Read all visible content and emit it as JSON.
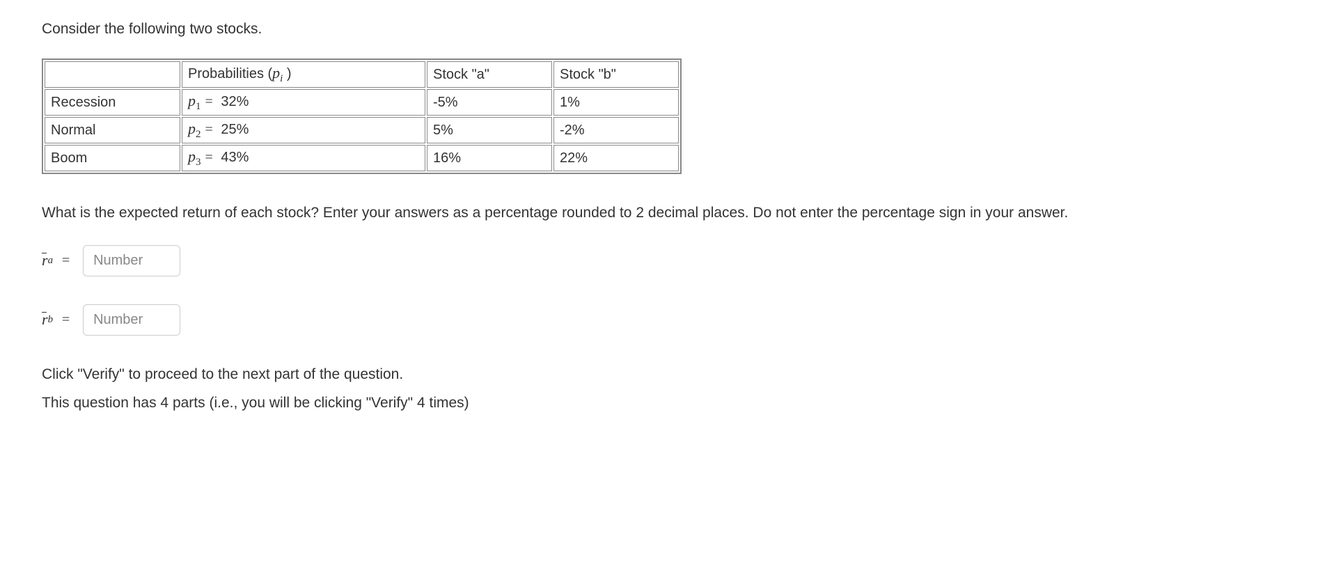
{
  "intro": "Consider the following two stocks.",
  "table": {
    "headers": {
      "state": "",
      "prob_prefix": "Probabilities (",
      "prob_var": "p",
      "prob_sub": "i",
      "prob_suffix": "  )",
      "stock_a": "Stock \"a\"",
      "stock_b": "Stock \"b\""
    },
    "rows": [
      {
        "state": "Recession",
        "p_var": "p",
        "p_sub": "1",
        "p_eq": "=",
        "p_val": "32%",
        "a": "-5%",
        "b": "1%"
      },
      {
        "state": "Normal",
        "p_var": "p",
        "p_sub": "2",
        "p_eq": "=",
        "p_val": "25%",
        "a": "5%",
        "b": "-2%"
      },
      {
        "state": "Boom",
        "p_var": "p",
        "p_sub": "3",
        "p_eq": "=",
        "p_val": "43%",
        "a": "16%",
        "b": "22%"
      }
    ]
  },
  "question": "What is the expected return of each stock? Enter your answers as a percentage rounded to 2 decimal places.  Do not enter the percentage sign in your answer.",
  "answers": {
    "ra": {
      "var": "r",
      "sub": "a",
      "eq": "=",
      "placeholder": "Number"
    },
    "rb": {
      "var": "r",
      "sub": "b",
      "eq": "=",
      "placeholder": "Number"
    }
  },
  "footer": {
    "line1": "Click \"Verify\" to proceed to the next part of the question.",
    "line2": "This question has 4 parts (i.e., you will be clicking \"Verify\" 4 times)"
  }
}
